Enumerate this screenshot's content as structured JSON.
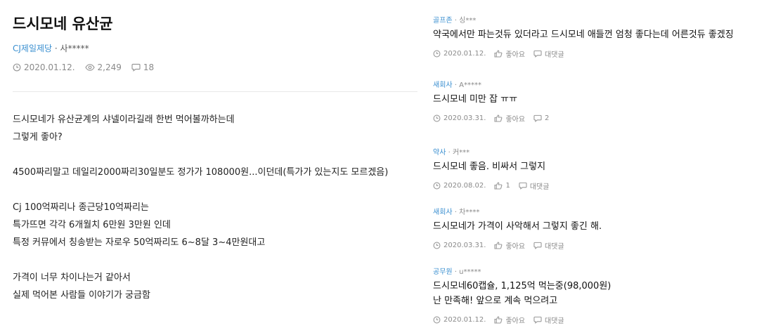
{
  "post": {
    "title": "드시모네 유산균",
    "company": "CJ제일제당",
    "sep": " · ",
    "author": "사*****",
    "date": "2020.01.12.",
    "views": "2,249",
    "comments_count": "18",
    "body": [
      "드시모네가 유산균계의 샤넬이라길래 한번 먹어볼까하는데",
      "그렇게 좋아?",
      "",
      "4500짜리말고 데일리2000짜리30일분도 정가가 108000원...이던데(특가가 있는지도 모르겠음)",
      "",
      "Cj 100억짜리나 종근당10억짜리는",
      "특가뜨면 각각 6개월치 6만원 3만원 인데",
      "특정 커뮤에서 칭송받는 자로우 50억짜리도 6~8달 3~4만원대고",
      "",
      "가격이 너무 차이나는거 같아서",
      "실제 먹어본 사람들 이야기가 궁금함"
    ]
  },
  "comments": [
    {
      "company": "골프존",
      "author": "싱***",
      "lines": [
        "약국에서만 파는것듀 있더라고 드시모네 애들껀 엄청 좋다는데 어른것듀 좋겠징"
      ],
      "date": "2020.01.12.",
      "like": "좋아요",
      "reply": "대댓글"
    },
    {
      "company": "새회사",
      "author": "A*****",
      "lines": [
        "드시모네 미만 잡 ㅠㅠ"
      ],
      "date": "2020.03.31.",
      "like": "좋아요",
      "reply": "2"
    },
    {
      "company": "약사",
      "author": "커***",
      "lines": [
        "드시모네 좋음. 비싸서 그렇지"
      ],
      "date": "2020.08.02.",
      "like": "1",
      "reply": "대댓글"
    },
    {
      "company": "새회사",
      "author": "차****",
      "lines": [
        "드시모네가 가격이 사악해서 그렇지 좋긴 해."
      ],
      "date": "2020.03.31.",
      "like": "좋아요",
      "reply": "대댓글"
    },
    {
      "company": "공무원",
      "author": "u*****",
      "lines": [
        "드시모네60캡슐, 1,125억 먹는중(98,000원)",
        "난 만족해! 앞으로 계속 먹으려고"
      ],
      "date": "2020.01.12.",
      "like": "좋아요",
      "reply": "대댓글"
    }
  ],
  "icons": {
    "clock": "clock-icon",
    "eye": "eye-icon",
    "comment": "comment-icon",
    "thumb": "thumbs-up-icon"
  }
}
